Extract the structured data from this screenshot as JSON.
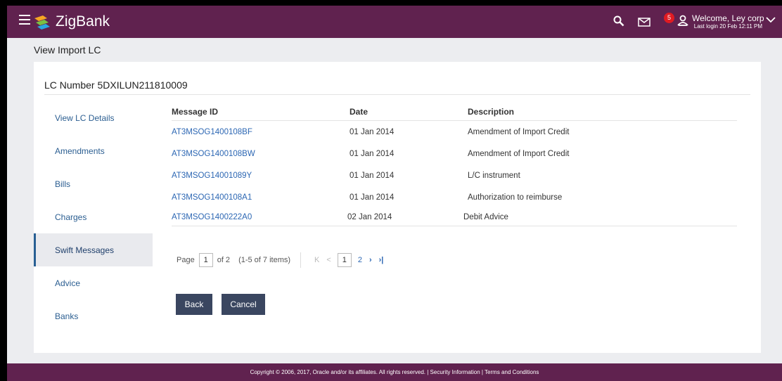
{
  "header": {
    "brand": "ZigBank",
    "notification_count": "5",
    "welcome": "Welcome, Ley corp",
    "last_login": "Last login 20 Feb 12:11 PM"
  },
  "page_title": "View Import LC",
  "lc_number": "LC Number 5DXILUN211810009",
  "sidenav": [
    {
      "label": "View LC Details",
      "active": false
    },
    {
      "label": "Amendments",
      "active": false
    },
    {
      "label": "Bills",
      "active": false
    },
    {
      "label": "Charges",
      "active": false
    },
    {
      "label": "Swift Messages",
      "active": true
    },
    {
      "label": "Advice",
      "active": false
    },
    {
      "label": "Banks",
      "active": false
    }
  ],
  "table": {
    "columns": [
      "Message ID",
      "Date",
      "Description"
    ],
    "rows": [
      [
        "AT3MSOG1400108BF",
        "01 Jan 2014",
        "Amendment of Import Credit"
      ],
      [
        "AT3MSOG1400108BW",
        "01 Jan 2014",
        "Amendment of Import Credit"
      ],
      [
        "AT3MSOG14001089Y",
        "01 Jan 2014",
        "L/C instrument"
      ],
      [
        "AT3MSOG1400108A1",
        "01 Jan 2014",
        "Authorization to reimburse"
      ],
      [
        "AT3MSOG1400222A0",
        "02 Jan 2014",
        "Debit Advice"
      ]
    ]
  },
  "pager": {
    "page_label": "Page",
    "current_page": "1",
    "of_label": "of 2",
    "items_label": "(1-5 of 7 items)",
    "page_buttons": [
      "1",
      "2"
    ]
  },
  "buttons": {
    "back": "Back",
    "cancel": "Cancel"
  },
  "footer": "Copyright © 2006, 2017, Oracle and/or its affiliates. All rights reserved. | Security Information | Terms and Conditions",
  "colors": {
    "topbar": "#60224f",
    "link": "#2b66b3",
    "button": "#3a4660",
    "badge": "#e01b22"
  }
}
